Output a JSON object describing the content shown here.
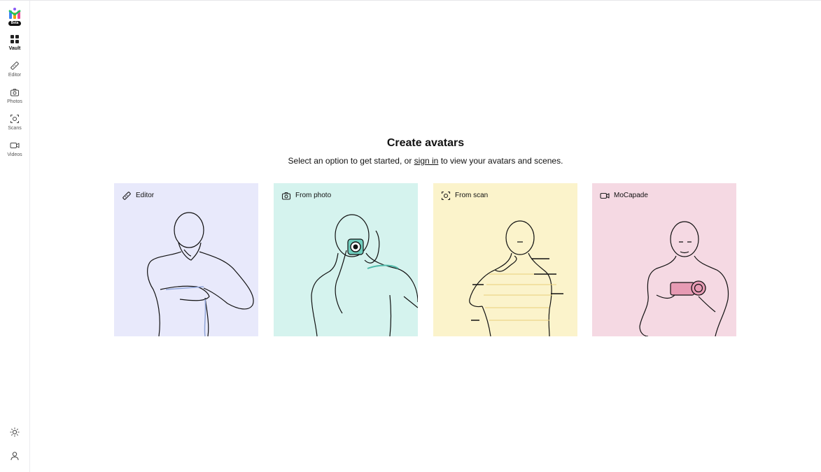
{
  "sidebar": {
    "logo_badge": "Beta",
    "items": [
      {
        "label": "Vault",
        "icon": "grid-icon",
        "active": true
      },
      {
        "label": "Editor",
        "icon": "ruler-icon",
        "active": false
      },
      {
        "label": "Photos",
        "icon": "camera-icon",
        "active": false
      },
      {
        "label": "Scans",
        "icon": "scan-icon",
        "active": false
      },
      {
        "label": "Videos",
        "icon": "video-icon",
        "active": false
      }
    ],
    "bottom_icons": [
      "sun-icon",
      "user-icon"
    ]
  },
  "main": {
    "title": "Create avatars",
    "subtitle_before": "Select an option to get started, or",
    "subtitle_link": "sign in",
    "subtitle_after": "to view your avatars and scenes.",
    "cards": [
      {
        "label": "Editor",
        "icon": "ruler-icon",
        "bg": "#e8e9fb"
      },
      {
        "label": "From photo",
        "icon": "camera-icon",
        "bg": "#d5f3ee"
      },
      {
        "label": "From scan",
        "icon": "scan-icon",
        "bg": "#fbf3cb"
      },
      {
        "label": "MoCapade",
        "icon": "video-icon",
        "bg": "#f5d9e3"
      }
    ]
  },
  "colors": {
    "accent_pink": "#e79bb4",
    "accent_teal": "#6fcdbd",
    "accent_yellow": "#f0d98a"
  }
}
